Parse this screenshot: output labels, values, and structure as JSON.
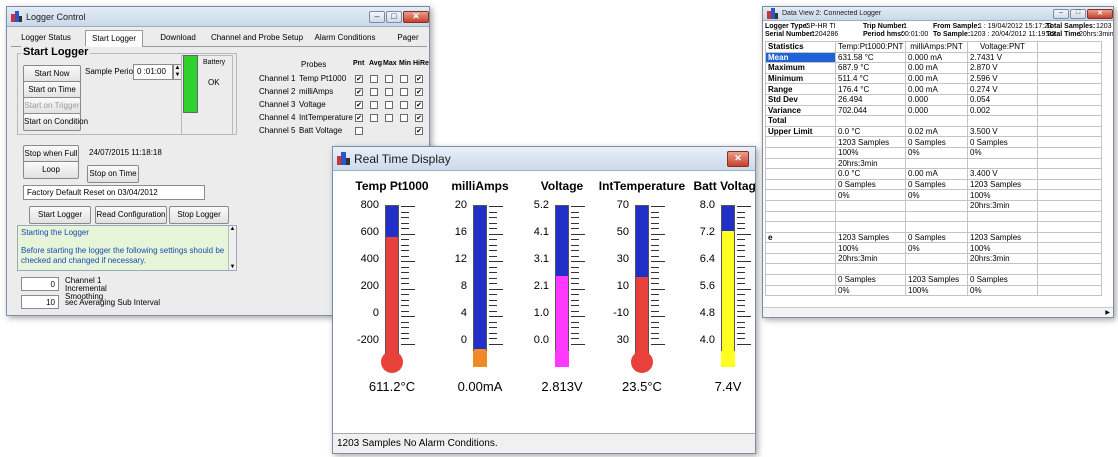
{
  "logger_control": {
    "title": "Logger Control",
    "tabs": [
      "Logger Status",
      "Start Logger",
      "Download",
      "Channel and Probe Setup",
      "Alarm Conditions",
      "Pager"
    ],
    "start_logger": {
      "group_label": "Start Logger",
      "start_now": "Start Now",
      "start_on_time": "Start on Time",
      "start_on_trigger": "Start on Trigger",
      "start_on_condition": "Start on Condition",
      "sample_period_label": "Sample Period",
      "sample_period_value": "0 :01:00",
      "battery_label": "Battery",
      "battery_status": "OK",
      "battery_color": "#2fd12f"
    },
    "probes": {
      "header": "Probes",
      "col_headers": [
        "Pnt",
        "Avg",
        "Max",
        "Min",
        "HiRes"
      ],
      "rows": [
        {
          "channel": "Channel 1",
          "name": "Temp Pt1000",
          "checks": [
            "✔",
            "",
            "",
            "",
            "✔"
          ]
        },
        {
          "channel": "Channel 2",
          "name": "milliAmps",
          "checks": [
            "✔",
            "",
            "",
            "",
            "✔"
          ]
        },
        {
          "channel": "Channel 3",
          "name": "Voltage",
          "checks": [
            "✔",
            "",
            "",
            "",
            "✔"
          ]
        },
        {
          "channel": "Channel 4",
          "name": "IntTemperature",
          "checks": [
            "✔",
            "",
            "",
            "",
            "✔"
          ]
        },
        {
          "channel": "Channel 5",
          "name": "Batt Voltage",
          "checks": [
            "",
            "",
            "",
            "",
            "✔"
          ]
        }
      ]
    },
    "stop_when_full": "Stop when Full",
    "loop": "Loop",
    "stop_on_time": "Stop on Time",
    "datetime": "24/07/2015 11:18:18",
    "reset_text": "Factory Default Reset on 03/04/2012",
    "start_logger_btn": "Start Logger",
    "read_configuration_btn": "Read Configuration",
    "stop_logger_btn": "Stop Logger",
    "info_title": "Starting the Logger",
    "info_text": "Before starting the logger the following settings should be checked and changed if necessary.",
    "smoothing_value": "0",
    "smoothing_label": "Channel 1 Incremental Smoothing",
    "averaging_value": "10",
    "averaging_label": "sec Averaging Sub Interval"
  },
  "data_view": {
    "title": "Data View 2: Connected Logger",
    "header": {
      "logger_type_label": "Logger Type:",
      "logger_type": "GP-HR TI",
      "serial_label": "Serial Number:",
      "serial": "1204286",
      "trip_label": "Trip Number:",
      "trip": "1",
      "period_label": "Period hms:",
      "period": "00:01:00",
      "from_label": "From Sample:",
      "from": "1 : 19/04/2012 15:17:23",
      "to_label": "To   Sample:",
      "to": "1203 : 20/04/2012 11:19:23",
      "total_samples_label": "Total Samples:",
      "total_samples": "1203",
      "total_time_label": "Total Time",
      "total_time": "20hrs:3min"
    },
    "columns": [
      "Statistics",
      "Temp:Pt1000:PNT",
      "milliAmps:PNT",
      "Voltage:PNT"
    ],
    "rows": [
      [
        "Mean",
        "631.58 °C",
        "0.000 mA",
        "2.7431 V"
      ],
      [
        "Maximum",
        "687.9 °C",
        "0.00 mA",
        "2.870 V"
      ],
      [
        "Minimum",
        "511.4 °C",
        "0.00 mA",
        "2.596 V"
      ],
      [
        "Range",
        "176.4 °C",
        "0.00 mA",
        "0.274 V"
      ],
      [
        "Std Dev",
        "26.494",
        "0.000",
        "0.054"
      ],
      [
        "Variance",
        "702.044",
        "0.000",
        "0.002"
      ],
      [
        "Total",
        "",
        "",
        ""
      ],
      [
        "Upper Limit",
        "0.0 °C",
        "0.02 mA",
        "3.500 V"
      ],
      [
        "",
        "1203 Samples",
        "0 Samples",
        "0 Samples"
      ],
      [
        "",
        "100%",
        "0%",
        "0%"
      ],
      [
        "",
        "20hrs:3min",
        "",
        ""
      ],
      [
        "",
        "0.0 °C",
        "0.00 mA",
        "3.400 V"
      ],
      [
        "",
        "0 Samples",
        "0 Samples",
        "1203 Samples"
      ],
      [
        "",
        "0%",
        "0%",
        "100%"
      ],
      [
        "",
        "",
        "",
        "20hrs:3min"
      ],
      [
        "",
        "",
        "",
        ""
      ],
      [
        "",
        "",
        "",
        ""
      ],
      [
        "e",
        "1203 Samples",
        "0 Samples",
        "1203 Samples"
      ],
      [
        "",
        "100%",
        "0%",
        "100%"
      ],
      [
        "",
        "20hrs:3min",
        "",
        "20hrs:3min"
      ],
      [
        "",
        "",
        "",
        ""
      ],
      [
        "",
        "0 Samples",
        "1203 Samples",
        "0 Samples"
      ],
      [
        "",
        "0%",
        "100%",
        "0%"
      ]
    ]
  },
  "realtime": {
    "title": "Real Time Display",
    "status": "1203 Samples   No Alarm Conditions.",
    "gauges": [
      {
        "name": "Temp Pt1000",
        "ticks": [
          "800",
          "600",
          "400",
          "200",
          "0",
          "-200"
        ],
        "min": -200,
        "max": 800,
        "value": 611.2,
        "reading": "611.2°C",
        "color": "#e8403a",
        "bulb_color": "#e8403a"
      },
      {
        "name": "milliAmps",
        "ticks": [
          "20",
          "16",
          "12",
          "8",
          "4",
          "0"
        ],
        "min": 0,
        "max": 20,
        "value": 0.0,
        "reading": "0.00mA",
        "color": "#f08a24",
        "bulb_color": "#f08a24"
      },
      {
        "name": "Voltage",
        "ticks": [
          "5.2",
          "4.1",
          "3.1",
          "2.1",
          "1.0",
          "0.0"
        ],
        "min": 0.0,
        "max": 5.2,
        "value": 2.813,
        "reading": "2.813V",
        "color": "#ff38ff",
        "bulb_color": "#ff38ff"
      },
      {
        "name": "IntTemperature",
        "ticks": [
          "70",
          "50",
          "30",
          "10",
          "-10",
          "30"
        ],
        "min": -30,
        "max": 70,
        "value": 23.5,
        "reading": "23.5°C",
        "color": "#e8403a",
        "bulb_color": "#e8403a"
      },
      {
        "name": "Batt Voltage",
        "ticks": [
          "8.0",
          "7.2",
          "6.4",
          "5.6",
          "4.8",
          "4.0"
        ],
        "min": 4.0,
        "max": 8.0,
        "value": 7.4,
        "reading": "7.4V",
        "color": "#ffff22",
        "bulb_color": "#ffff22"
      }
    ]
  }
}
